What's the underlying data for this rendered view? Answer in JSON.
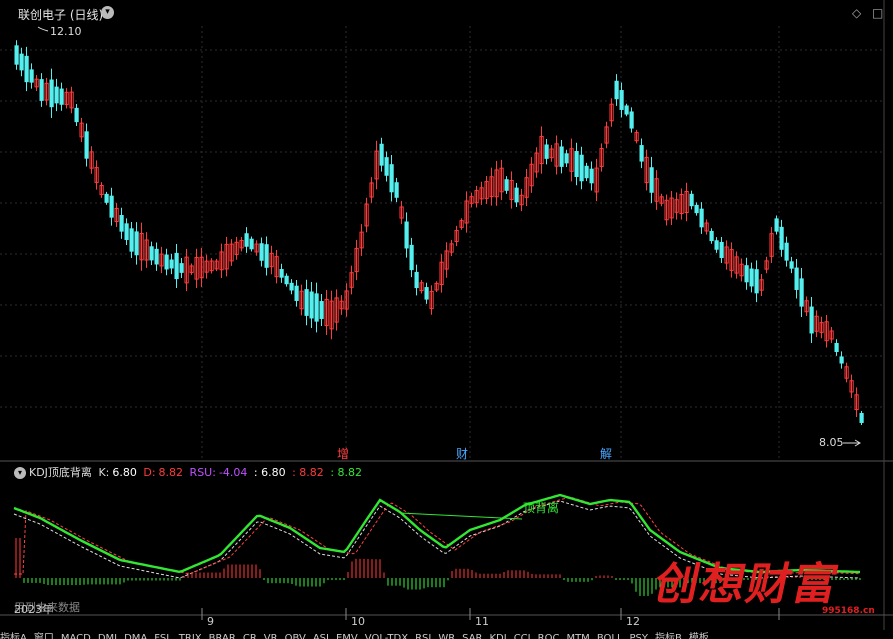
{
  "header": {
    "title": "联创电子 (日线)",
    "right_controls": [
      "◇",
      "□"
    ]
  },
  "price_chart": {
    "high_label": "12.10",
    "low_label": "8.05",
    "event_markers": [
      {
        "label": "增",
        "color": "#ff4040"
      },
      {
        "label": "财",
        "color": "#4aa8ff"
      },
      {
        "label": "解",
        "color": "#4aa8ff"
      }
    ],
    "colors": {
      "up": "#ff3b3b",
      "down": "#54f0f0",
      "grid": "#333333"
    }
  },
  "indicator": {
    "name": "KDJ顶底背离",
    "k_label": "K:",
    "k_value": "6.80",
    "d_label": "D:",
    "d_value": "8.82",
    "rsu_label": "RSU:",
    "rsu_value": "-4.04",
    "v1": ": 6.80",
    "v2": ": 8.82",
    "v3": ": 8.82",
    "divergence_label": "顶背离",
    "future_label": "用到未来数据",
    "colors": {
      "k": "#ffffff",
      "d": "#33e633",
      "j": "#ff3333",
      "hist_up": "#e03030",
      "hist_down": "#30d030"
    }
  },
  "time_axis": {
    "labels": [
      "2023年",
      "9",
      "10",
      "11",
      "12"
    ]
  },
  "bottom_tabs": [
    "指标A",
    "窗口",
    "MACD",
    "DMI",
    "DMA",
    "FSL",
    "TRIX",
    "BRAR",
    "CR",
    "VR",
    "OBV",
    "ASI",
    "EMV",
    "VOL-TDX",
    "RSI",
    "WR",
    "SAR",
    "KDJ",
    "CCI",
    "ROC",
    "MTM",
    "BOLL",
    "PSY",
    "指标B",
    "模板"
  ],
  "watermark": {
    "text": "创想财富",
    "url": "995168.cn"
  }
}
